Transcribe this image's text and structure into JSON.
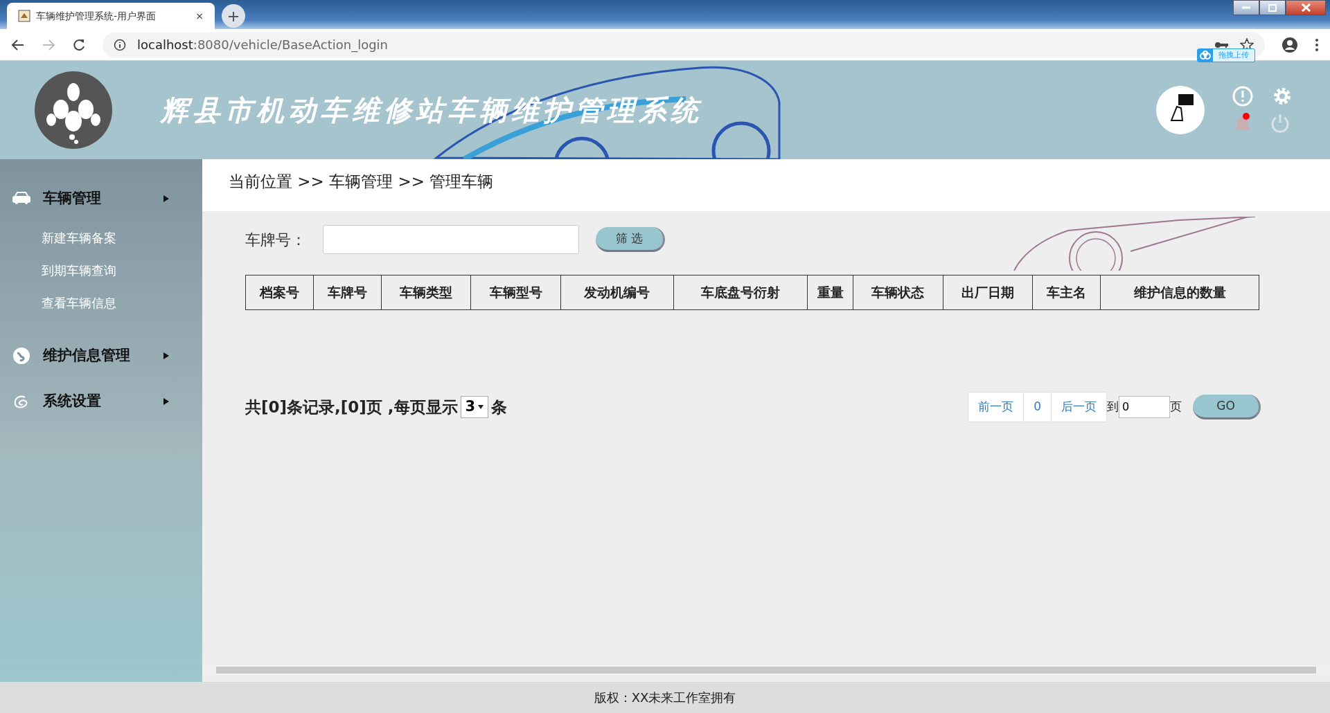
{
  "browser": {
    "tab_title": "车辆维护管理系统-用户界面",
    "url_host": "localhost",
    "url_path": ":8080/vehicle/BaseAction_login",
    "upload_tooltip": "拖拽上传",
    "tab_close": "×"
  },
  "header": {
    "title": "辉县市机动车维修站车辆维护管理系统",
    "notification_unread": true
  },
  "sidebar": {
    "groups": [
      {
        "label": "车辆管理",
        "children": [
          "新建车辆备案",
          "到期车辆查询",
          "查看车辆信息"
        ]
      },
      {
        "label": "维护信息管理"
      },
      {
        "label": "系统设置"
      }
    ]
  },
  "breadcrumb": "当前位置 >> 车辆管理 >> 管理车辆",
  "filter": {
    "label": "车牌号：",
    "button": "筛 选"
  },
  "table": {
    "columns": [
      "档案号",
      "车牌号",
      "车辆类型",
      "车辆型号",
      "发动机编号",
      "车底盘号衍射",
      "重量",
      "车辆状态",
      "出厂日期",
      "车主名",
      "维护信息的数量"
    ]
  },
  "pagination": {
    "summary": "共[0]条记录,[0]页 ,每页显示",
    "page_size": "3",
    "unit": "条",
    "prev": "前一页",
    "current": "0",
    "next": "后一页",
    "goto_label": "到",
    "goto_value": "0",
    "page_unit": "页",
    "go": "GO"
  },
  "footer": "版权：XX未来工作室拥有"
}
